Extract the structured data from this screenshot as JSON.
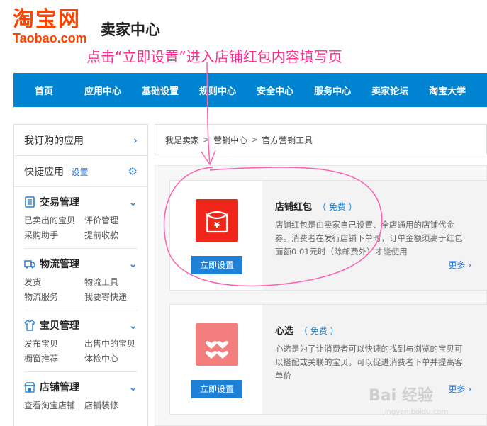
{
  "header": {
    "logo_cn": "淘宝网",
    "logo_en": "Taobao.com",
    "title": "卖家中心"
  },
  "annotation": {
    "text": "点击“立即设置”进入店铺红包内容填写页",
    "color": "#ff2d8e"
  },
  "nav": {
    "items": [
      "首页",
      "应用中心",
      "基础设置",
      "规则中心",
      "安全中心",
      "服务中心",
      "卖家论坛",
      "淘宝大学"
    ]
  },
  "sidebar": {
    "subscribed": "我订购的应用",
    "quick": "快捷应用",
    "quick_setting": "设置",
    "groups": [
      {
        "title": "交易管理",
        "icon": "document-icon",
        "links": [
          "已卖出的宝贝",
          "评价管理",
          "采购助手",
          "提前收款"
        ]
      },
      {
        "title": "物流管理",
        "icon": "truck-icon",
        "links": [
          "发货",
          "物流工具",
          "物流服务",
          "我要寄快递"
        ]
      },
      {
        "title": "宝贝管理",
        "icon": "shirt-icon",
        "links": [
          "发布宝贝",
          "出售中的宝贝",
          "橱窗推荐",
          "体检中心"
        ]
      },
      {
        "title": "店铺管理",
        "icon": "shop-icon",
        "links": [
          "查看淘宝店铺",
          "店铺装修"
        ]
      }
    ]
  },
  "breadcrumb": [
    "我是卖家",
    "营销中心",
    "官方营销工具"
  ],
  "cards": [
    {
      "title": "店铺红包",
      "free": "（ 免费 ）",
      "desc": "店铺红包是由卖家自己设置、全店通用的店铺代金券。消费者在发行店铺下单时，订单金额须高于红包面额0.01元时（除邮费外）才能使用",
      "button": "立即设置",
      "more": "更多 ›",
      "icon": "red-envelope-icon",
      "icon_color": "#f0261b"
    },
    {
      "title": "心选",
      "free": "（ 免费 ）",
      "desc": "心选是为了让消费者可以快速的找到与浏览的宝贝可以搭配或关联的宝贝，可以促进消费者下单并提高客单价",
      "button": "立即设置",
      "more": "更多 ›",
      "icon": "hearts-icon",
      "icon_color": "#f47e7e"
    }
  ],
  "watermark": {
    "text": "Bai 经验",
    "sub": "jingyan.baidu.com"
  }
}
